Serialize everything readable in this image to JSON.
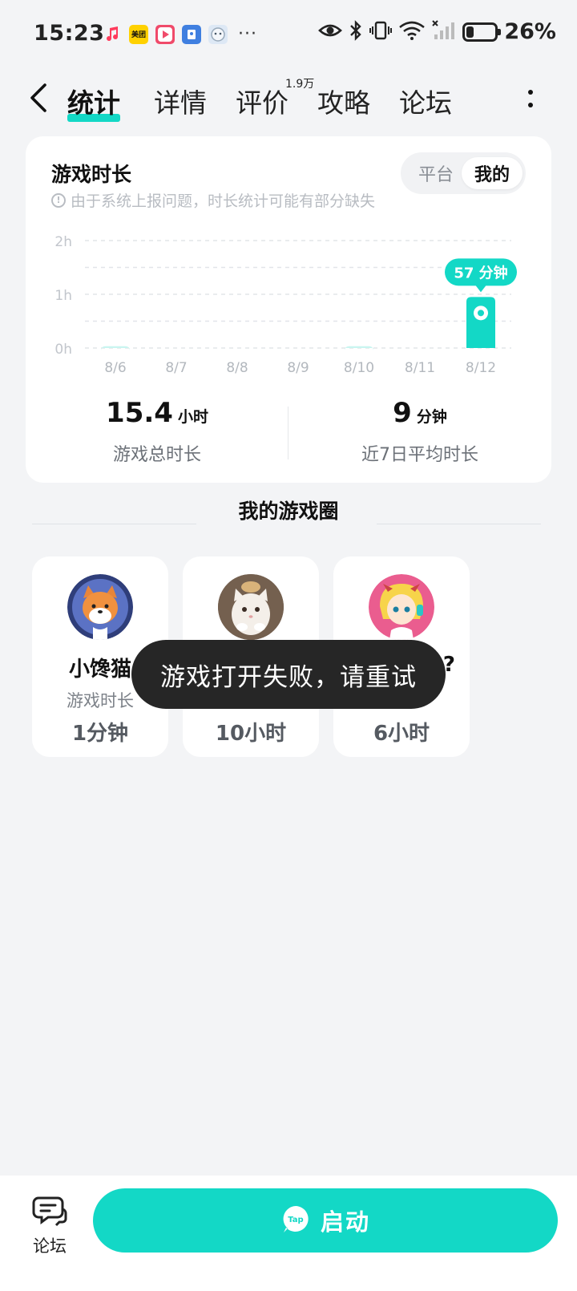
{
  "status_bar": {
    "time": "15:23",
    "app_icons": [
      "music-icon",
      "meituan-icon",
      "video-player-icon",
      "app-icon",
      "cloud-app-icon"
    ],
    "meituan_text": "美团",
    "more": "···",
    "battery_level": 0.26,
    "battery_text": "26%"
  },
  "nav": {
    "tabs": [
      {
        "label": "统计",
        "active": true
      },
      {
        "label": "详情",
        "active": false
      },
      {
        "label": "评价",
        "active": false
      },
      {
        "label": "攻略",
        "active": false
      },
      {
        "label": "论坛",
        "active": false
      }
    ],
    "review_badge": "1.9万"
  },
  "stats": {
    "title": "游戏时长",
    "note": "由于系统上报问题，时长统计可能有部分缺失",
    "toggle": {
      "options": [
        "平台",
        "我的"
      ],
      "selected": "我的"
    },
    "total_value": "15.4",
    "total_unit": "小时",
    "total_label": "游戏总时长",
    "avg_value": "9",
    "avg_unit": "分钟",
    "avg_label": "近7日平均时长"
  },
  "chart_data": {
    "type": "bar",
    "categories": [
      "8/6",
      "8/7",
      "8/8",
      "8/9",
      "8/10",
      "8/11",
      "8/12"
    ],
    "values": [
      2,
      0,
      0,
      0,
      2,
      0,
      57
    ],
    "value_unit": "minutes",
    "ytick_labels": [
      "0h",
      "1h",
      "2h"
    ],
    "ylim": [
      0,
      120
    ],
    "highlight_label": "57 分钟",
    "highlight_index": 6,
    "grid": true,
    "color": "#13d8c6",
    "faint_color": "#c9f5f0"
  },
  "section": {
    "title": "我的游戏圈"
  },
  "circle": [
    {
      "name": "小馋猫",
      "label": "游戏时长",
      "value": "1分钟",
      "avatar": "shiba-dog-avatar"
    },
    {
      "name": "",
      "label": "",
      "value": "10小时",
      "avatar": "kitten-avatar"
    },
    {
      "name": "?",
      "label": "",
      "value": "6小时",
      "avatar": "anime-girl-avatar"
    }
  ],
  "toast": "游戏打开失败，请重试",
  "bottom": {
    "forum_label": "论坛",
    "launch_label": "启动",
    "tap_logo_text": "Tap"
  },
  "colors": {
    "accent": "#13d8c6",
    "background": "#f3f4f6",
    "toast": "#262626"
  }
}
